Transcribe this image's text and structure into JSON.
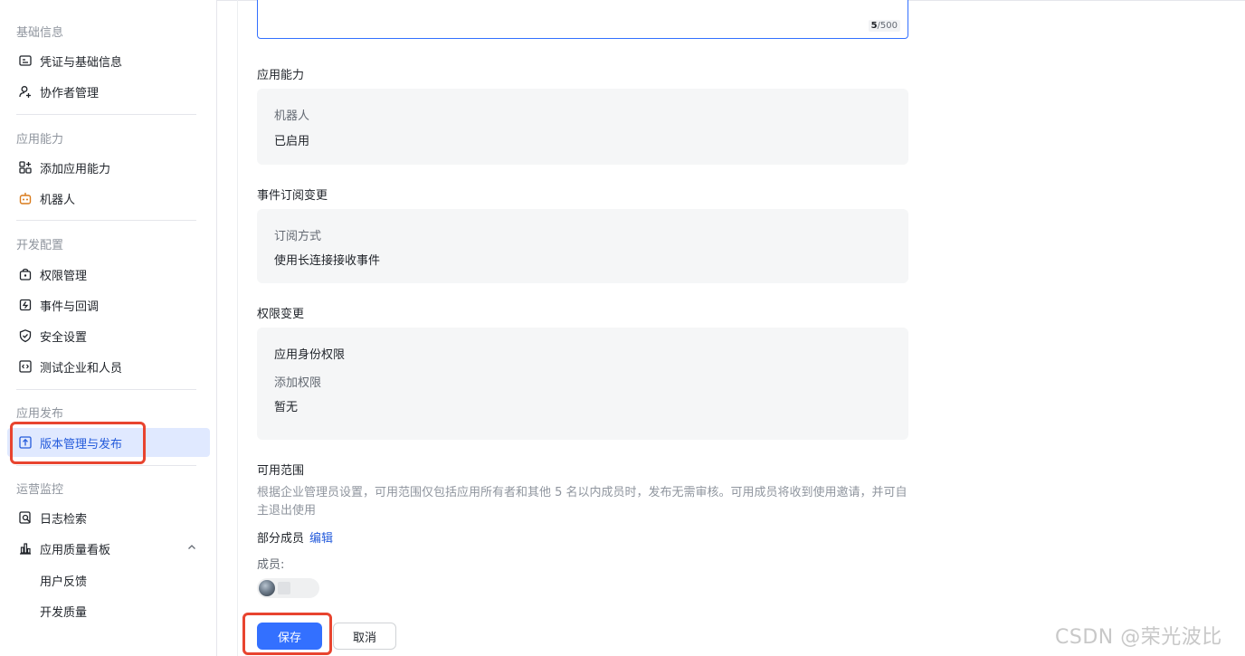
{
  "sidebar": {
    "groups": [
      {
        "title": "基础信息",
        "items": [
          {
            "label": "凭证与基础信息",
            "icon": "credential-icon"
          },
          {
            "label": "协作者管理",
            "icon": "add-user-icon"
          }
        ]
      },
      {
        "title": "应用能力",
        "items": [
          {
            "label": "添加应用能力",
            "icon": "apps-add-icon"
          },
          {
            "label": "机器人",
            "icon": "robot-icon"
          }
        ]
      },
      {
        "title": "开发配置",
        "items": [
          {
            "label": "权限管理",
            "icon": "permission-lock-icon"
          },
          {
            "label": "事件与回调",
            "icon": "event-icon"
          },
          {
            "label": "安全设置",
            "icon": "shield-icon"
          },
          {
            "label": "测试企业和人员",
            "icon": "code-icon"
          }
        ]
      },
      {
        "title": "应用发布",
        "items": [
          {
            "label": "版本管理与发布",
            "icon": "upload-icon"
          }
        ]
      },
      {
        "title": "运营监控",
        "items": [
          {
            "label": "日志检索",
            "icon": "log-search-icon"
          },
          {
            "label": "应用质量看板",
            "icon": "bar-chart-icon"
          },
          {
            "label": "用户反馈",
            "icon": ""
          },
          {
            "label": "开发质量",
            "icon": ""
          }
        ]
      }
    ],
    "active_item": "版本管理与发布"
  },
  "main": {
    "description_counter": {
      "current": "5",
      "max": "/500"
    },
    "app_capability": {
      "title": "应用能力",
      "label": "机器人",
      "value": "已启用"
    },
    "event_subscription": {
      "title": "事件订阅变更",
      "label": "订阅方式",
      "value": "使用长连接接收事件"
    },
    "permission_change": {
      "title": "权限变更",
      "subtitle": "应用身份权限",
      "label": "添加权限",
      "value": "暂无"
    },
    "availability": {
      "title": "可用范围",
      "description": "根据企业管理员设置，可用范围仅包括应用所有者和其他 5 名以内成员时，发布无需审核。可用成员将收到使用邀请，并可自主退出使用",
      "scope": "部分成员",
      "edit_label": "编辑",
      "members_label": "成员:"
    },
    "buttons": {
      "save": "保存",
      "cancel": "取消"
    }
  },
  "watermark": "CSDN @荣光波比",
  "colors": {
    "accent": "#3370ff",
    "annotation": "#e8442f",
    "active_bg": "#e0e9ff"
  }
}
